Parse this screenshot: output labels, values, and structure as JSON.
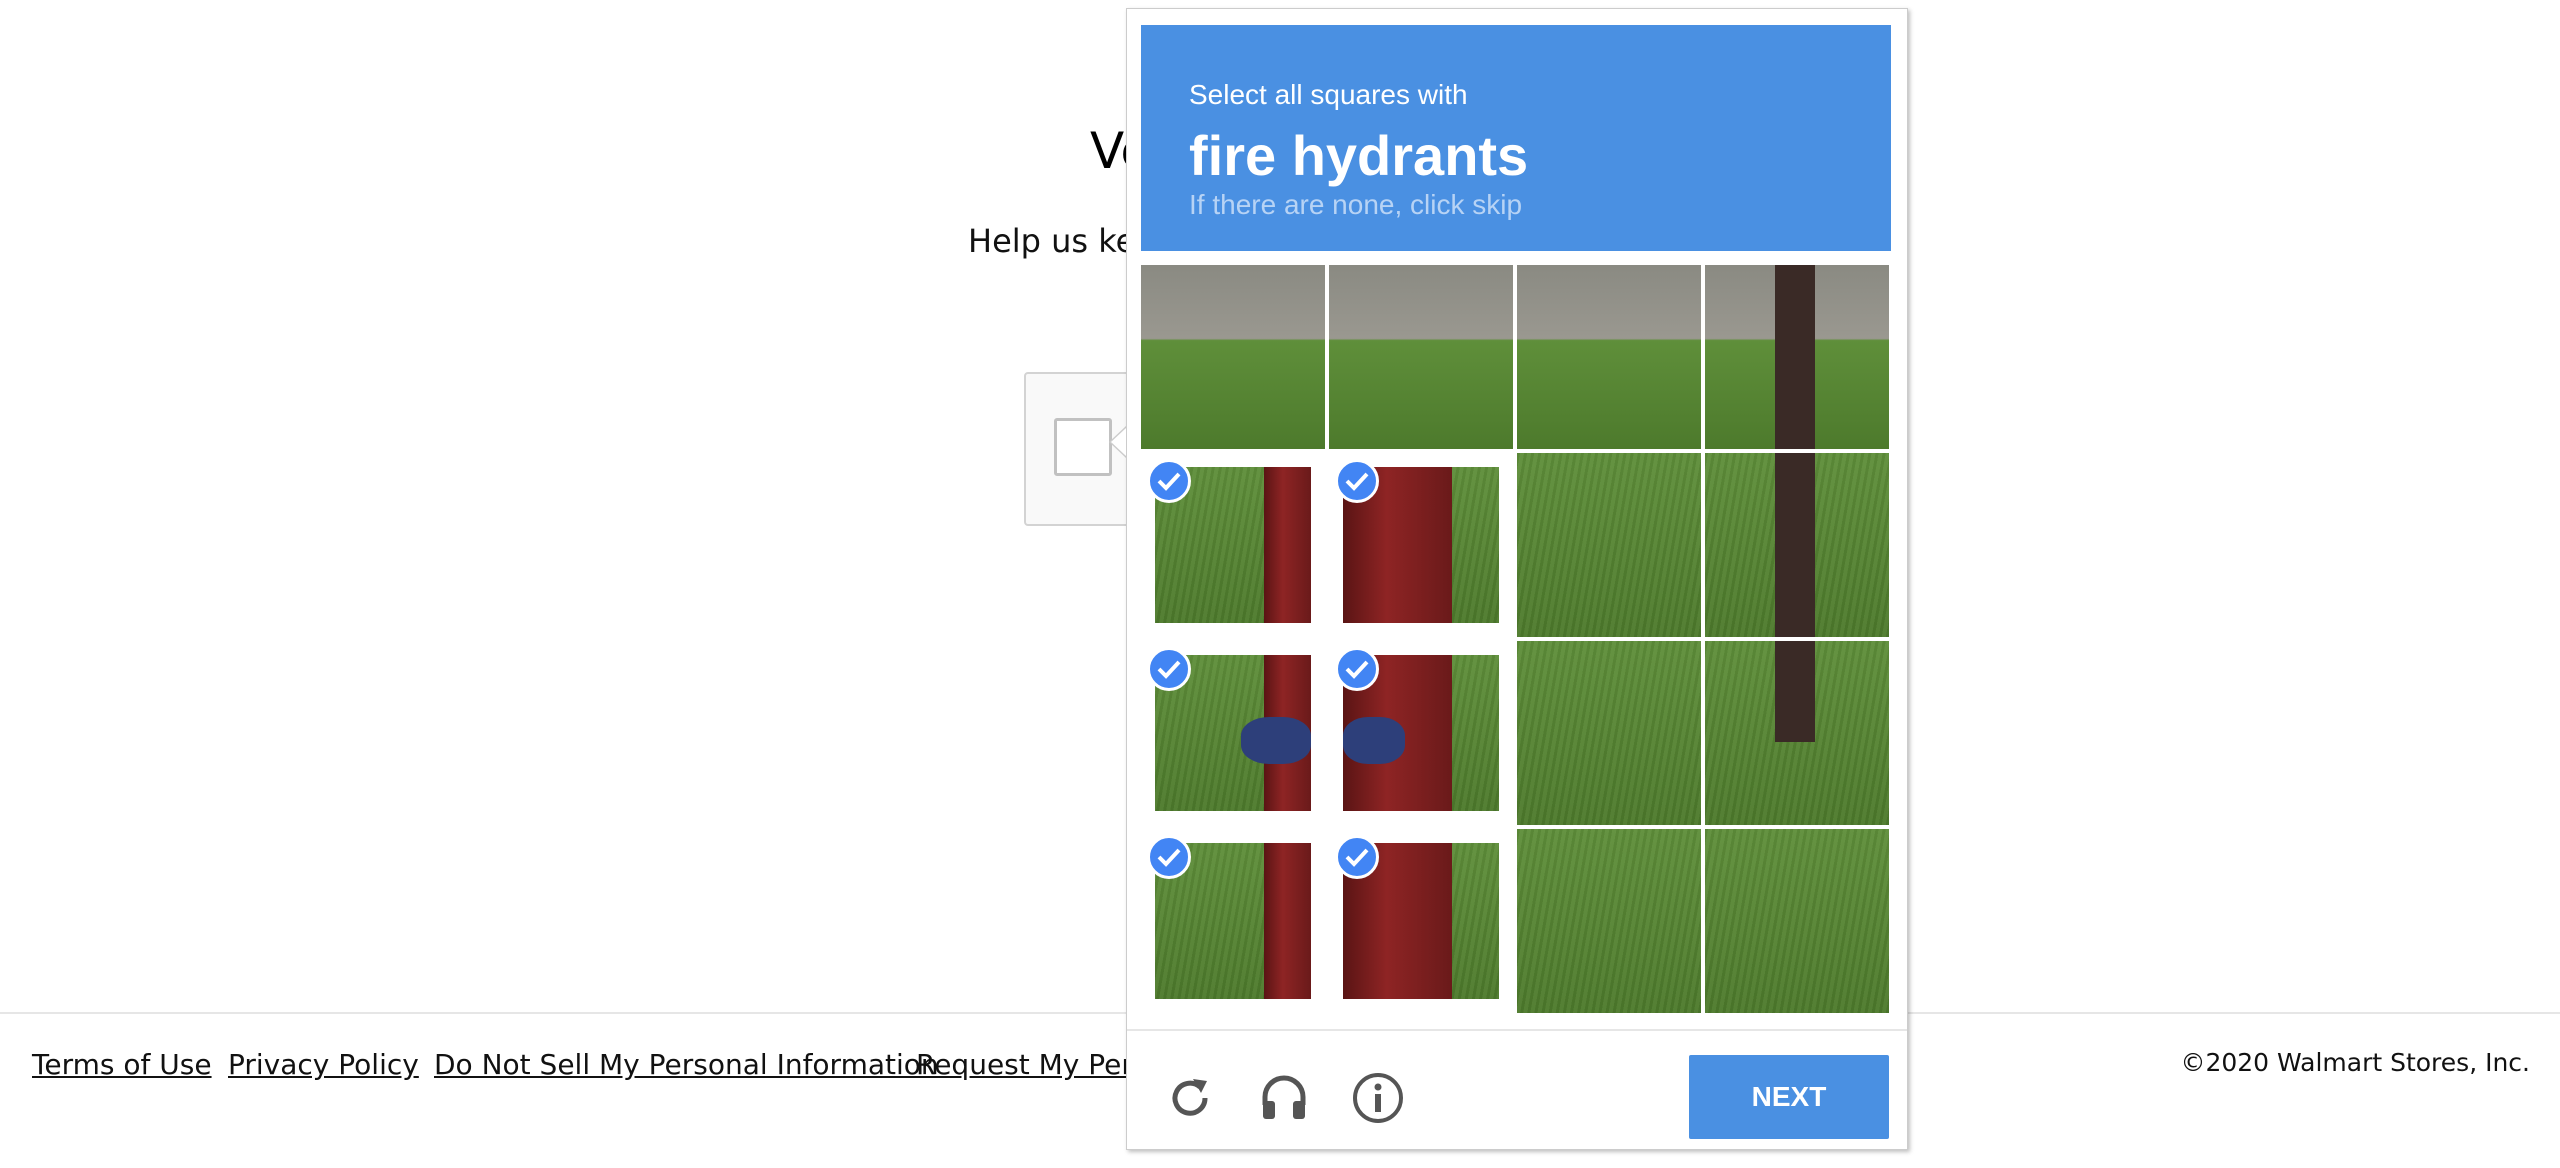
{
  "page": {
    "title_partial": "Ve",
    "subtitle_partial": "Help us kee"
  },
  "challenge": {
    "instruction": "Select all squares with",
    "target": "fire hydrants",
    "hint": "If there are none, click skip",
    "grid": {
      "rows": 4,
      "cols": 4
    },
    "selected_tiles": [
      [
        1,
        0
      ],
      [
        1,
        1
      ],
      [
        2,
        0
      ],
      [
        2,
        1
      ],
      [
        3,
        0
      ],
      [
        3,
        1
      ]
    ],
    "next_label": "NEXT",
    "icons": [
      "reload-icon",
      "audio-icon",
      "info-icon",
      "checkmark-icon"
    ],
    "colors": {
      "banner": "#4a90e2",
      "check_badge": "#4285f4",
      "next_button": "#4a90e2"
    }
  },
  "footer": {
    "links": [
      "Terms of Use",
      "Privacy Policy",
      "Do Not Sell My Personal Information",
      "Request My Perso"
    ],
    "copyright": "©2020 Walmart Stores, Inc."
  }
}
